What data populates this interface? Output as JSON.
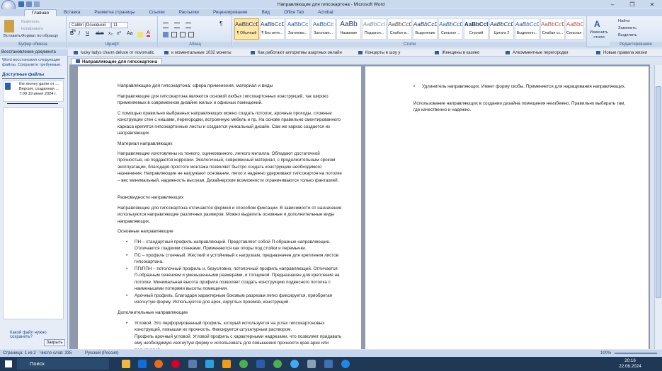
{
  "window": {
    "title": "Направляющие для гипсокартона - Microsoft Word"
  },
  "tabs": [
    "Главная",
    "Вставка",
    "Разметка страницы",
    "Ссылки",
    "Рассылки",
    "Рецензирование",
    "Вид",
    "Office Tab",
    "Acrobat"
  ],
  "ribbon": {
    "clipboard": {
      "paste": "Вставить",
      "cut": "Вырезать",
      "copy": "Копировать",
      "format": "Формат по образцу",
      "label": "Буфер обмена"
    },
    "font": {
      "name": "Calibri (Основной те",
      "size": "11",
      "label": "Шрифт"
    },
    "paragraph": {
      "label": "Абзац"
    },
    "styles": {
      "label": "Стили",
      "items": [
        {
          "sample": "AaBbCcDc",
          "name": "¶ Обычный"
        },
        {
          "sample": "AaBbCcDc",
          "name": "¶ Без инте..."
        },
        {
          "sample": "AaBbCc",
          "name": "Заголово..."
        },
        {
          "sample": "AaBbCc",
          "name": "Заголово..."
        },
        {
          "sample": "AaBb",
          "name": "Название"
        },
        {
          "sample": "AaBbCcI",
          "name": "Подзагол..."
        },
        {
          "sample": "AaBbCcDc",
          "name": "Слабое в..."
        },
        {
          "sample": "AaBbCcDc",
          "name": "Выделение"
        },
        {
          "sample": "AaBbCcDc",
          "name": "Сильное ..."
        },
        {
          "sample": "AaBbCcDc",
          "name": "Строгий"
        },
        {
          "sample": "AaBbCcDc",
          "name": "Цитата 2"
        },
        {
          "sample": "AaBbCcDc",
          "name": "Выделенн..."
        },
        {
          "sample": "AaBbCcDc",
          "name": "Слабая сс..."
        },
        {
          "sample": "AaBbCcDc",
          "name": "Сильная ..."
        }
      ]
    },
    "change_styles": "Изменить стили",
    "editing": {
      "find": "Найти",
      "replace": "Заменить",
      "select": "Выделить",
      "label": "Редактирование"
    }
  },
  "doc_tabs": [
    "lucky ladys charm deluxe от novomatic",
    "и моментальные 1032 монеты",
    "Как работают алгоритмы азартных онлайн",
    "Концерты в шоу у",
    "Женщины в казино",
    "Алкомментные перегородки",
    "Новые правила жизни"
  ],
  "active_doc_tab": "Направляющие для гипсокартона",
  "recovery": {
    "title": "Восстановление документа",
    "desc": "Word восстановил следующие файлы. Сохраните требуемые.",
    "files_header": "Доступные файлы",
    "file_name": "the money game от ...",
    "file_version": "Версия, созданная ...",
    "file_time": "7:09 19 июня 2024 г.",
    "help": "Какой файл нужно сохранить?",
    "close": "Закрыть"
  },
  "page1": {
    "title": "Направляющие для гипсокартона: сфера применения, материал и виды",
    "p1": "Направляющие для гипсокартона являются основой любых гипсокартонных конструкций, так широко применяемых в современном дизайне жилых и офисных помещений.",
    "p2": "С помощью правильно выбранных направляющих можно создать потолок, арочные проходы, сложные конструкции стен с нишами, перегородки, встроенную мебель и пр. На основе правильно смонтированного каркаса крепятся гипсокартонные листы и создается уникальный дизайн. Сам же каркас создается из направляющих.",
    "h1": "Материал направляющих",
    "p3": "Направляющие изготовлены из тонкого, оцинкованного, легкого металла. Обладают достаточной прочностью, не поддаются коррозии. Экологичный, современный материал, с продолжительным сроком эксплуатации, благодаря простоте монтажа позволяет быстро создать конструкцию необходимого назначения. Направляющие не нагружают основание, легко и надежно удерживают гипсокартон на потолке – вес минимальный, надежность высокая. Дизайнерские возможности ограничиваются только фантазией.",
    "h2": "Разновидности направляющих",
    "p4": "Направляющие для гипсокартона отличаются формой и способом фиксации. В зависимости от назначения используются направляющие различных размеров. Можно выделить основные и дополнительные виды направляющих.",
    "h3": "Основные направляющие",
    "b1": "ПН – стандартный профиль направляющий. Представляет собой П-образные направляющие. Отличаются гладкими стенками. Применяются как опоры под стойки и перемычки.",
    "b2": "ПС – профиль стоечный. Жесткий и устойчивый к нагрузкам, предназначен для крепления листов гипсокартона.",
    "b3": "ПП/ППН – потолочный профиль и, безусловно, потолочный профиль направляющий. Отличается П-образным сечением и уменьшенными размерами, и толщиной. Предназначен для крепления на потолке. Минимальная высота профиля позволяет создать конструкцию подвесного потолка с наименьшими потерями высоты помещения.",
    "b4": "Арочный профиль. Благодаря характерным боковым разрезам легко фиксируется, приобретая изогнутую форму. Используется для арок, округлых проемов, конструкций.",
    "h4": "Дополнительные направляющие",
    "b5": "Угловой. Это перфорированный профиль, который используется на углах гипсокартоновых конструкций, повышая их прочность. Фиксируется штукатурным раствором.",
    "b6": "Профиль арочный угловой. Угловой профиль с характерными надрезами, что позволяет придавать ему необходимую изогнутую форму и использовать для повышения прочности края арки или полукруглой"
  },
  "page2": {
    "b1": "Удлинитель направляющих. Имеет форму скобы. Применяется для наращивания направляющих.",
    "p1": "Использование направляющих в создании дизайна помещения неизбежно. Правильно выбирать там, где качественно и надежно."
  },
  "status": {
    "page": "Страница: 1 из 2",
    "words": "Число слов: 335",
    "lang": "Русский (Россия)",
    "zoom": "100%"
  },
  "taskbar": {
    "search": "Поиск",
    "time": "20:16",
    "date": "22.06.2024"
  }
}
